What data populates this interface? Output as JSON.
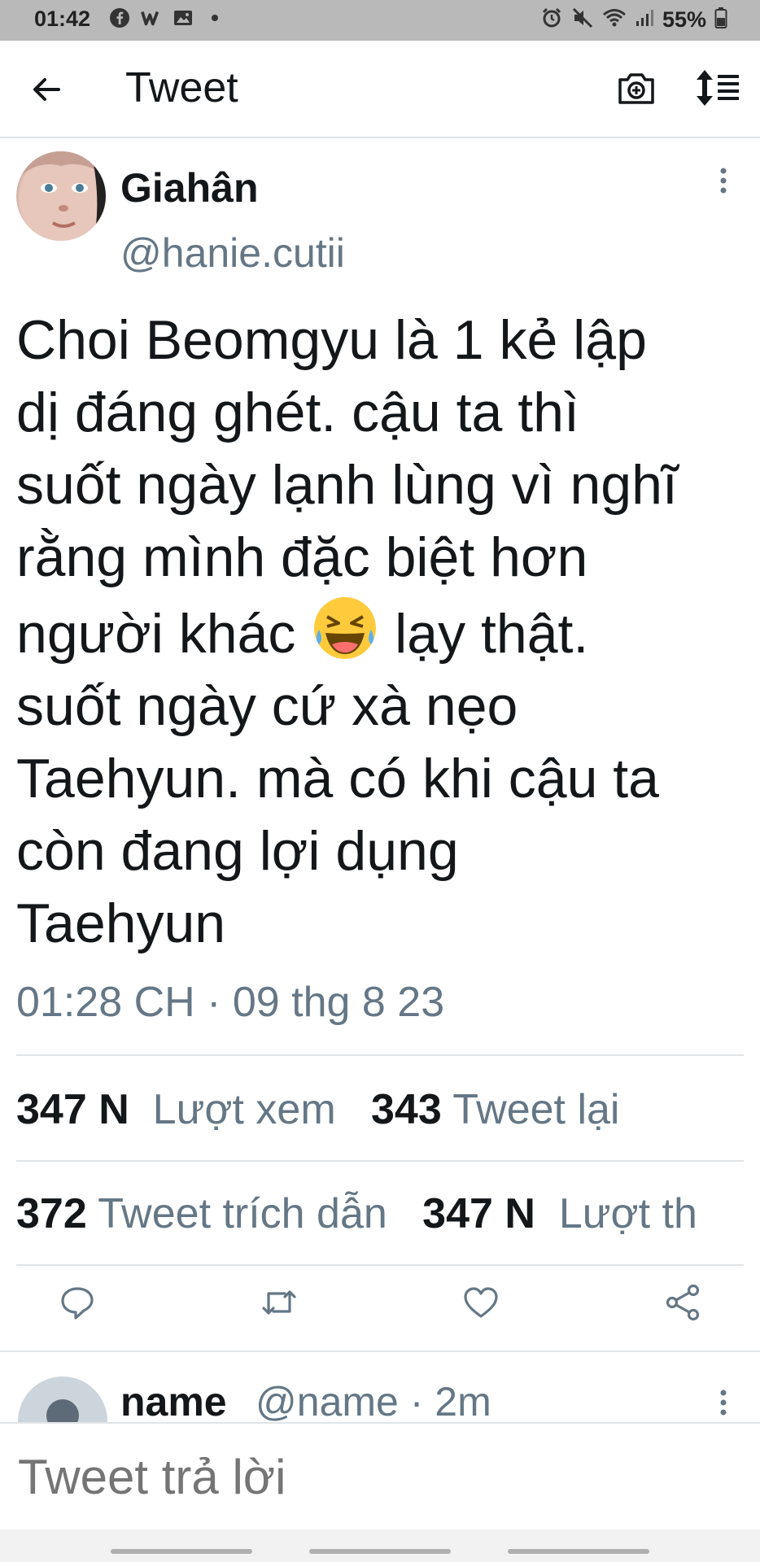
{
  "status_bar": {
    "time": "01:42",
    "battery": "55%",
    "left_icons": [
      "facebook-icon",
      "w-app-icon",
      "gallery-icon",
      "dot-icon"
    ],
    "right_icons": [
      "alarm-icon",
      "mute-icon",
      "wifi-icon",
      "signal-icon",
      "battery-icon"
    ]
  },
  "header": {
    "title": "Tweet",
    "icons": [
      "back-arrow-icon",
      "camera-plus-icon",
      "sort-lines-icon"
    ]
  },
  "tweet": {
    "display_name": "Giahân",
    "handle": "@hanie.cutii",
    "text_before_emoji": "Choi Beomgyu là 1 kẻ lập\ndị đáng ghét. cậu ta thì\nsuốt ngày lạnh lùng vì nghĩ\nrằng mình đặc biệt hơn\nngười khác ",
    "emoji": "rolling-on-floor-laughing-emoji",
    "text_after_emoji": " lạy thật.\nsuốt ngày cứ xà nẹo\nTaehyun. mà có khi cậu ta\ncòn đang lợi dụng\nTaehyun",
    "timestamp": "01:28 CH · 09 thg 8 23"
  },
  "stats": {
    "views_value": "347 N",
    "views_label": "Lượt xem",
    "retweets_value": "343",
    "retweets_label": "Tweet lại",
    "quotes_value": "372",
    "quotes_label": "Tweet trích dẫn",
    "likes_value": "347 N",
    "likes_label": "Lượt th"
  },
  "actions": [
    "reply-icon",
    "retweet-icon",
    "like-icon",
    "share-icon"
  ],
  "reply_preview": {
    "name": "name",
    "meta": "@name · 2m"
  },
  "composer": {
    "placeholder": "Tweet trả lời"
  },
  "colors": {
    "text_primary": "#14171a",
    "text_secondary": "#657786",
    "divider": "#e1e5e8",
    "status_bar_bg": "#b9b9b9"
  }
}
